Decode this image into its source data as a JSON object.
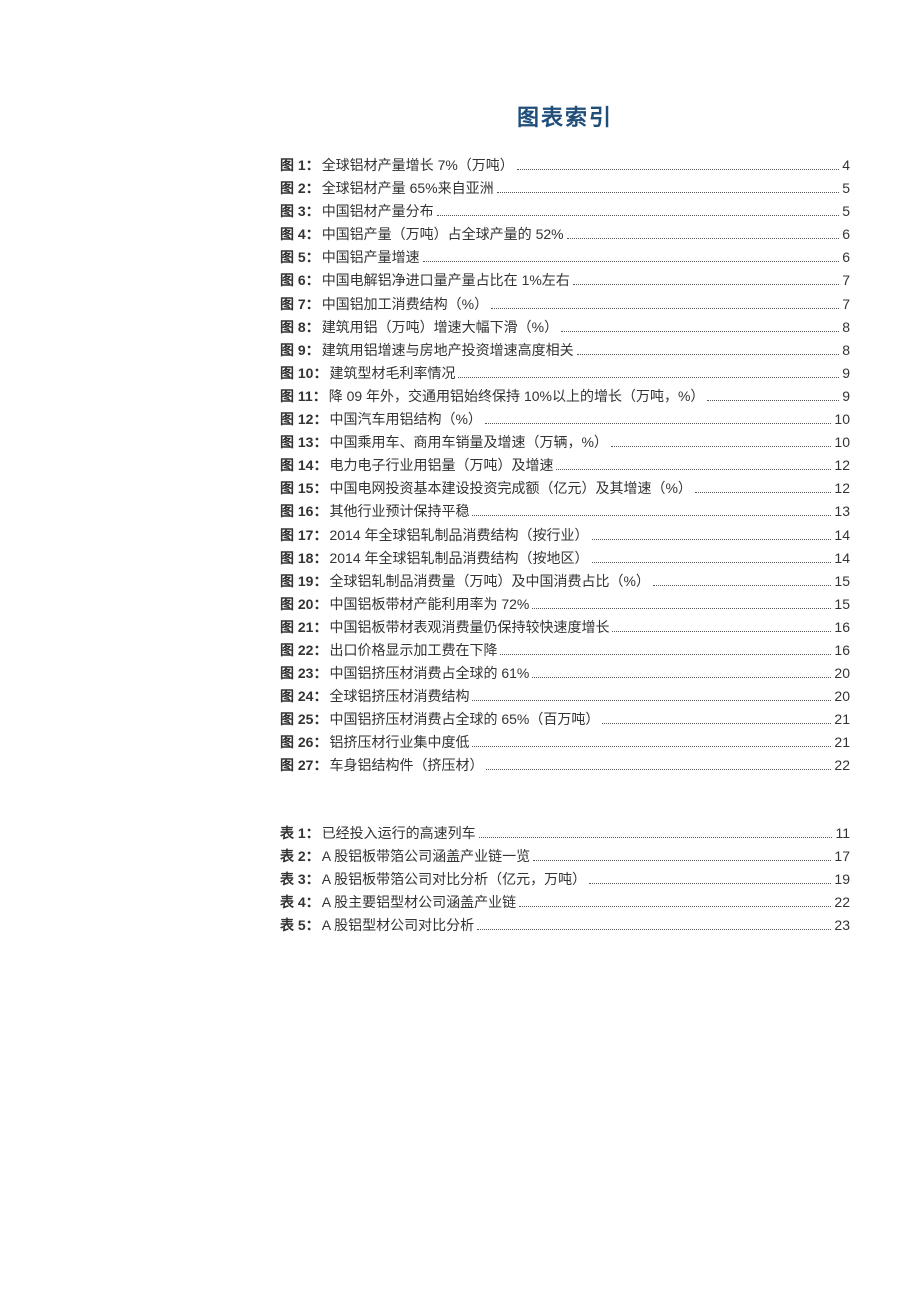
{
  "title": "图表索引",
  "figures": [
    {
      "label": "图 1：",
      "text": "全球铝材产量增长 7%（万吨）",
      "page": "4"
    },
    {
      "label": "图 2：",
      "text": "全球铝材产量 65%来自亚洲",
      "page": "5"
    },
    {
      "label": "图 3：",
      "text": "中国铝材产量分布",
      "page": "5"
    },
    {
      "label": "图 4：",
      "text": "中国铝产量（万吨）占全球产量的 52%",
      "page": "6"
    },
    {
      "label": "图 5：",
      "text": "中国铝产量增速",
      "page": "6"
    },
    {
      "label": "图 6：",
      "text": "中国电解铝净进口量产量占比在 1%左右",
      "page": "7"
    },
    {
      "label": "图 7：",
      "text": "中国铝加工消费结构（%）",
      "page": "7"
    },
    {
      "label": "图 8：",
      "text": "建筑用铝（万吨）增速大幅下滑（%）",
      "page": "8"
    },
    {
      "label": "图 9：",
      "text": "建筑用铝增速与房地产投资增速高度相关",
      "page": "8"
    },
    {
      "label": "图 10：",
      "text": "建筑型材毛利率情况",
      "page": "9"
    },
    {
      "label": "图 11：",
      "text": "降 09 年外，交通用铝始终保持 10%以上的增长（万吨，%）",
      "page": "9"
    },
    {
      "label": "图 12：",
      "text": "中国汽车用铝结构（%）",
      "page": "10"
    },
    {
      "label": "图 13：",
      "text": "中国乘用车、商用车销量及增速（万辆，%）",
      "page": "10"
    },
    {
      "label": "图 14：",
      "text": "电力电子行业用铝量（万吨）及增速",
      "page": "12"
    },
    {
      "label": "图 15：",
      "text": "中国电网投资基本建设投资完成额（亿元）及其增速（%）",
      "page": "12"
    },
    {
      "label": "图 16：",
      "text": "其他行业预计保持平稳",
      "page": "13"
    },
    {
      "label": "图 17：",
      "text": "2014 年全球铝轧制品消费结构（按行业）",
      "page": "14"
    },
    {
      "label": "图 18：",
      "text": "2014 年全球铝轧制品消费结构（按地区）",
      "page": "14"
    },
    {
      "label": "图 19：",
      "text": "全球铝轧制品消费量（万吨）及中国消费占比（%）",
      "page": "15"
    },
    {
      "label": "图 20：",
      "text": "中国铝板带材产能利用率为 72%",
      "page": "15"
    },
    {
      "label": "图 21：",
      "text": "中国铝板带材表观消费量仍保持较快速度增长",
      "page": "16"
    },
    {
      "label": "图 22：",
      "text": "出口价格显示加工费在下降",
      "page": "16"
    },
    {
      "label": "图 23：",
      "text": "中国铝挤压材消费占全球的 61%",
      "page": "20"
    },
    {
      "label": "图 24：",
      "text": "全球铝挤压材消费结构",
      "page": "20"
    },
    {
      "label": "图 25：",
      "text": "中国铝挤压材消费占全球的 65%（百万吨）",
      "page": "21"
    },
    {
      "label": "图 26：",
      "text": "铝挤压材行业集中度低",
      "page": "21"
    },
    {
      "label": "图 27：",
      "text": "车身铝结构件（挤压材）",
      "page": "22"
    }
  ],
  "tables": [
    {
      "label": "表 1：",
      "text": "已经投入运行的高速列车",
      "page": "11"
    },
    {
      "label": "表 2：",
      "text": "A 股铝板带箔公司涵盖产业链一览",
      "page": "17"
    },
    {
      "label": "表 3：",
      "text": "A 股铝板带箔公司对比分析（亿元，万吨）",
      "page": "19"
    },
    {
      "label": "表 4：",
      "text": "A 股主要铝型材公司涵盖产业链",
      "page": "22"
    },
    {
      "label": "表 5：",
      "text": "A 股铝型材公司对比分析",
      "page": "23"
    }
  ]
}
